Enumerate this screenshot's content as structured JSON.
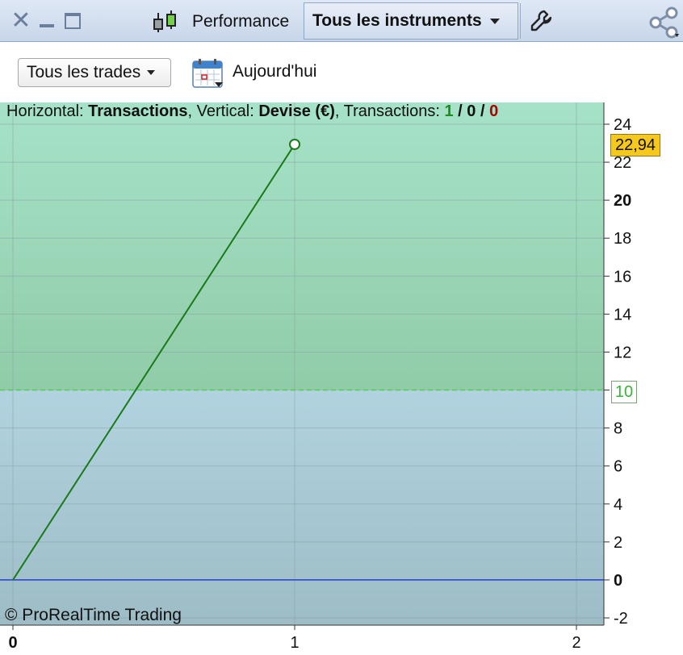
{
  "titlebar": {
    "close_icon": "close-icon",
    "performance_label": "Performance",
    "instruments_label": "Tous les instruments"
  },
  "toolbar": {
    "trades_filter": "Tous les trades",
    "date_label": "Aujourd'hui"
  },
  "info": {
    "horizontal_prefix": "Horizontal: ",
    "horizontal_value": "Transactions",
    "vertical_prefix": ", Vertical: ",
    "vertical_value": "Devise (€)",
    "transactions_prefix": ", Transactions: ",
    "winning": "1",
    "neutral": "0",
    "losing": "0",
    "slash": " / "
  },
  "copyright": "© ProRealTime Trading",
  "colors": {
    "upper_zone_top": "#a6e2c8",
    "upper_zone_bottom": "#90cca8",
    "lower_zone_top": "#b1d3df",
    "lower_zone_bottom": "#9dbcc6",
    "equity_line": "#1a7a1a",
    "zero_line": "#2a3fd0",
    "level_line": "#4fd04f",
    "last_value_badge": "#f7c81c"
  },
  "chart_data": {
    "type": "line",
    "x": [
      0,
      1
    ],
    "y": [
      0,
      22.94
    ],
    "xlim": [
      0,
      2
    ],
    "ylim": [
      -2,
      24
    ],
    "x_ticks": [
      "0",
      "1",
      "2"
    ],
    "y_ticks": [
      "-2",
      "0",
      "2",
      "4",
      "6",
      "8",
      "10",
      "12",
      "14",
      "16",
      "18",
      "20",
      "22",
      "24"
    ],
    "last_value_label": "22,94",
    "level_label": "10",
    "reference_level": 10,
    "baseline": 0,
    "grid": true
  }
}
